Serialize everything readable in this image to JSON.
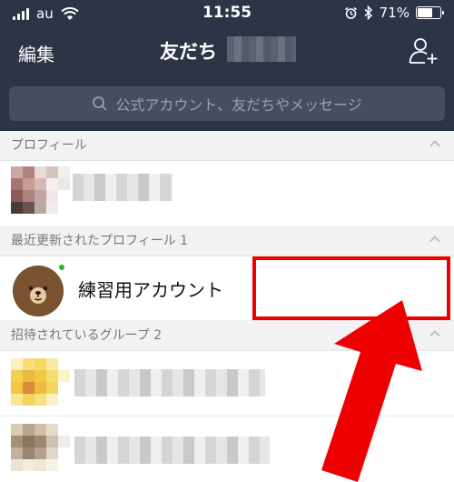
{
  "status_bar": {
    "carrier": "au",
    "time": "11:55",
    "battery_text": "71%",
    "battery_level": 0.71
  },
  "nav": {
    "edit_label": "編集",
    "title": "友だち",
    "add_friend_icon": "add-friend-icon"
  },
  "search": {
    "placeholder": "公式アカウント、友だちやメッセージ",
    "icon": "search-icon"
  },
  "sections": {
    "profile": "プロフィール",
    "recent": "最近更新されたプロフィール 1",
    "groups": "招待されているグループ 2"
  },
  "recent_items": [
    {
      "name": "練習用アカウント",
      "online": true
    }
  ],
  "colors": {
    "header_bg": "#2c3446",
    "search_bg": "#454d5e",
    "section_bg": "#f2f2f4",
    "online": "#19c21c",
    "annotation": "#ee0000"
  }
}
